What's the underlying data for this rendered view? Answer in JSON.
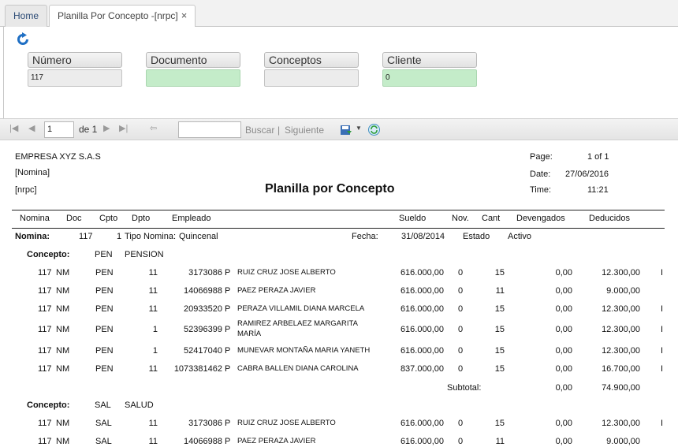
{
  "tabs": [
    {
      "label": "Home"
    },
    {
      "label": "Planilla Por Concepto -[nrpc]",
      "close": "×"
    }
  ],
  "form": {
    "fields": [
      {
        "label": "Número",
        "value": "117"
      },
      {
        "label": "Documento",
        "value": ""
      },
      {
        "label": "Conceptos",
        "value": ""
      },
      {
        "label": "Cliente",
        "value": "0"
      }
    ]
  },
  "toolbar": {
    "page": "1",
    "of_label": "de 1",
    "find_label": "Buscar",
    "separator": "|",
    "next_label": "Siguiente"
  },
  "report": {
    "company": "EMPRESA XYZ S.A.S",
    "subtitle1": "[Nomina]",
    "subtitle2": "[nrpc]",
    "title": "Planilla por Concepto",
    "page_label": "Page:",
    "page_value": "1 of 1",
    "date_label": "Date:",
    "date_value": "27/06/2016",
    "time_label": "Time:",
    "time_value": "11:21",
    "columns": [
      "Nomina",
      "Doc",
      "Cpto",
      "Dpto",
      "Empleado",
      "Sueldo",
      "Nov.",
      "Cant",
      "Devengados",
      "Deducidos"
    ],
    "nomina": {
      "label": "Nomina:",
      "number": "117",
      "tipo_num": "1",
      "tipo_label": "Tipo Nomina:",
      "tipo_value": "Quincenal",
      "fecha_label": "Fecha:",
      "fecha_value": "31/08/2014",
      "estado_label": "Estado",
      "estado_value": "Activo"
    },
    "groups": [
      {
        "label": "Concepto:",
        "code": "PEN",
        "name": "PENSION",
        "rows": [
          {
            "nomina": "117",
            "doc": "NM",
            "cpto": "PEN",
            "dpto": "11",
            "id": "3173086",
            "tipo": "P",
            "name": "RUIZ CRUZ JOSE ALBERTO",
            "sueldo": "616.000,00",
            "nov": "0",
            "cant": "15",
            "dev": "0,00",
            "ded": "12.300,00",
            "extra": "I"
          },
          {
            "nomina": "117",
            "doc": "NM",
            "cpto": "PEN",
            "dpto": "11",
            "id": "14066988",
            "tipo": "P",
            "name": "PAEZ PERAZA JAVIER",
            "sueldo": "616.000,00",
            "nov": "0",
            "cant": "11",
            "dev": "0,00",
            "ded": "9.000,00",
            "extra": ""
          },
          {
            "nomina": "117",
            "doc": "NM",
            "cpto": "PEN",
            "dpto": "11",
            "id": "20933520",
            "tipo": "P",
            "name": "PERAZA VILLAMIL DIANA MARCELA",
            "sueldo": "616.000,00",
            "nov": "0",
            "cant": "15",
            "dev": "0,00",
            "ded": "12.300,00",
            "extra": "I"
          },
          {
            "nomina": "117",
            "doc": "NM",
            "cpto": "PEN",
            "dpto": "1",
            "id": "52396399",
            "tipo": "P",
            "name": "RAMIREZ ARBELAEZ MARGARITA",
            "name2": "MARÍA",
            "sueldo": "616.000,00",
            "nov": "0",
            "cant": "15",
            "dev": "0,00",
            "ded": "12.300,00",
            "extra": "I"
          },
          {
            "nomina": "117",
            "doc": "NM",
            "cpto": "PEN",
            "dpto": "1",
            "id": "52417040",
            "tipo": "P",
            "name": "MUNEVAR MONTAÑA MARIA YANETH",
            "sueldo": "616.000,00",
            "nov": "0",
            "cant": "15",
            "dev": "0,00",
            "ded": "12.300,00",
            "extra": "I"
          },
          {
            "nomina": "117",
            "doc": "NM",
            "cpto": "PEN",
            "dpto": "11",
            "id": "1073381462",
            "tipo": "P",
            "name": "CABRA BALLEN DIANA CAROLINA",
            "sueldo": "837.000,00",
            "nov": "0",
            "cant": "15",
            "dev": "0,00",
            "ded": "16.700,00",
            "extra": "I"
          }
        ],
        "subtotal_label": "Subtotal:",
        "subtotal_dev": "0,00",
        "subtotal_ded": "74.900,00"
      },
      {
        "label": "Concepto:",
        "code": "SAL",
        "name": "SALUD",
        "rows": [
          {
            "nomina": "117",
            "doc": "NM",
            "cpto": "SAL",
            "dpto": "11",
            "id": "3173086",
            "tipo": "P",
            "name": "RUIZ CRUZ JOSE ALBERTO",
            "sueldo": "616.000,00",
            "nov": "0",
            "cant": "15",
            "dev": "0,00",
            "ded": "12.300,00",
            "extra": "I"
          },
          {
            "nomina": "117",
            "doc": "NM",
            "cpto": "SAL",
            "dpto": "11",
            "id": "14066988",
            "tipo": "P",
            "name": "PAEZ PERAZA JAVIER",
            "sueldo": "616.000,00",
            "nov": "0",
            "cant": "11",
            "dev": "0,00",
            "ded": "9.000,00",
            "extra": ""
          }
        ]
      }
    ]
  }
}
